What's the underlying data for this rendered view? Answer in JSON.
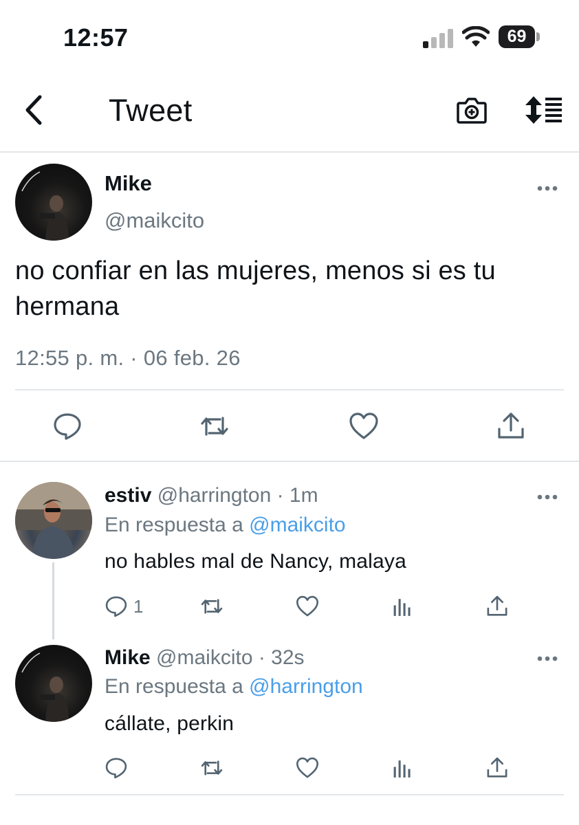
{
  "status_bar": {
    "time": "12:57",
    "battery": "69"
  },
  "header": {
    "title": "Tweet"
  },
  "tweet": {
    "name": "Mike",
    "handle": "@maikcito",
    "text": "no confiar en las mujeres, menos si es tu hermana",
    "timestamp": "12:55 p. m. · 06 feb. 26"
  },
  "replies": [
    {
      "name": "estiv",
      "meta": "@harrington · 1m",
      "reply_prefix": "En respuesta a ",
      "reply_to": "@maikcito",
      "text": "no hables mal de Nancy, malaya",
      "reply_count": "1"
    },
    {
      "name": "Mike",
      "meta": "@maikcito · 32s",
      "reply_prefix": "En respuesta a ",
      "reply_to": "@harrington",
      "text": "cállate, perkin",
      "reply_count": ""
    }
  ],
  "icons": {
    "back": "chevron-left-icon",
    "camera": "camera-plus-icon",
    "sort": "sort-list-icon",
    "more": "more-horizontal-icon",
    "reply": "comment-icon",
    "retweet": "retweet-icon",
    "like": "heart-icon",
    "share": "share-icon",
    "analytics": "analytics-icon"
  },
  "colors": {
    "link": "#4a9ee8",
    "secondary_text": "#6b7780"
  }
}
